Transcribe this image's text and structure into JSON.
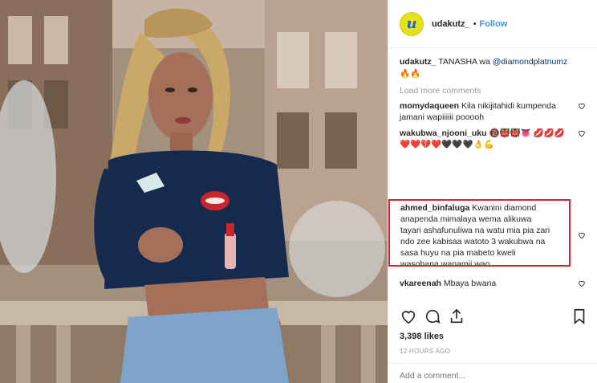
{
  "post": {
    "username": "udakutz_",
    "avatar_letter": "u",
    "follow_label": "Follow",
    "separator": "•"
  },
  "caption": {
    "username": "udakutz_",
    "text": "TANASHA wa",
    "mention": "@diamondplatnumz",
    "emoji": "🔥🔥"
  },
  "load_more": "Load more comments",
  "comments": [
    {
      "user": "momydaqueen",
      "text": "Kila nikijitahidi kumpenda jamani wapiiiiii pooooh"
    },
    {
      "user": "wakubwa_njooni_uku",
      "text": "🔞👹👹👅 💋💋💋❤️❤️💔❤️🖤🖤🖤👌💪"
    },
    {
      "user": "ahmed_binfaluga",
      "text": "Kwanini diamond anapenda mimalaya wema alikuwa tayari ashafunuliwa na watu mia pia zari ndo zee kabisaa watoto 3 wakubwa na sasa huyu na pia mabeto kweli wasohana wanamji wao"
    },
    {
      "user": "vkareenah",
      "text": "Mbaya bwana"
    }
  ],
  "likes": "3,398 likes",
  "time": "12 HOURS AGO",
  "add_comment_placeholder": "Add a comment..."
}
